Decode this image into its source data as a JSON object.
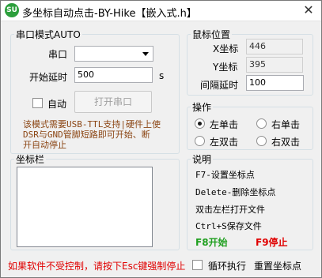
{
  "window": {
    "title": "多坐标自动点击-BY-Hike【嵌入式.h】",
    "icon_text": "SU",
    "close": "✕"
  },
  "serial": {
    "legend": "串口模式AUTO",
    "port_label": "串口",
    "port_value": "",
    "delay_label": "开始延时",
    "delay_value": "500",
    "delay_unit": "s",
    "auto_label": "自动",
    "auto_checked": false,
    "open_button": "打开串口",
    "note_line1": "该模式需要USB-TTL支持|硬件上使",
    "note_line2": "DSR与GND管脚短路即可开始、断",
    "note_line3": "开自动停止"
  },
  "mouse": {
    "legend": "鼠标位置",
    "x_label": "X坐标",
    "x_value": "446",
    "y_label": "Y坐标",
    "y_value": "395",
    "interval_label": "间隔延时",
    "interval_value": "100"
  },
  "action": {
    "legend": "操作",
    "left_single": "左单击",
    "right_single": "右单击",
    "left_double": "左双击",
    "right_double": "右双击",
    "selected": "left_single"
  },
  "coords": {
    "legend": "坐标栏"
  },
  "help": {
    "legend": "说明",
    "line1": "F7-设置坐标点",
    "line2": "Delete-删除坐标点",
    "line3": "双击左栏打开文件",
    "line4": "Ctrl+S保存文件",
    "f8": "F8开始",
    "f9": "F9停止"
  },
  "footer": {
    "warning": "如果软件不受控制，请按下Esc键强制停止",
    "loop_label": "循环执行",
    "loop_checked": false,
    "reset_label": "重置坐标点"
  },
  "colors": {
    "green": "#1f9f1f",
    "red": "#e00000",
    "note": "#8b4513"
  }
}
